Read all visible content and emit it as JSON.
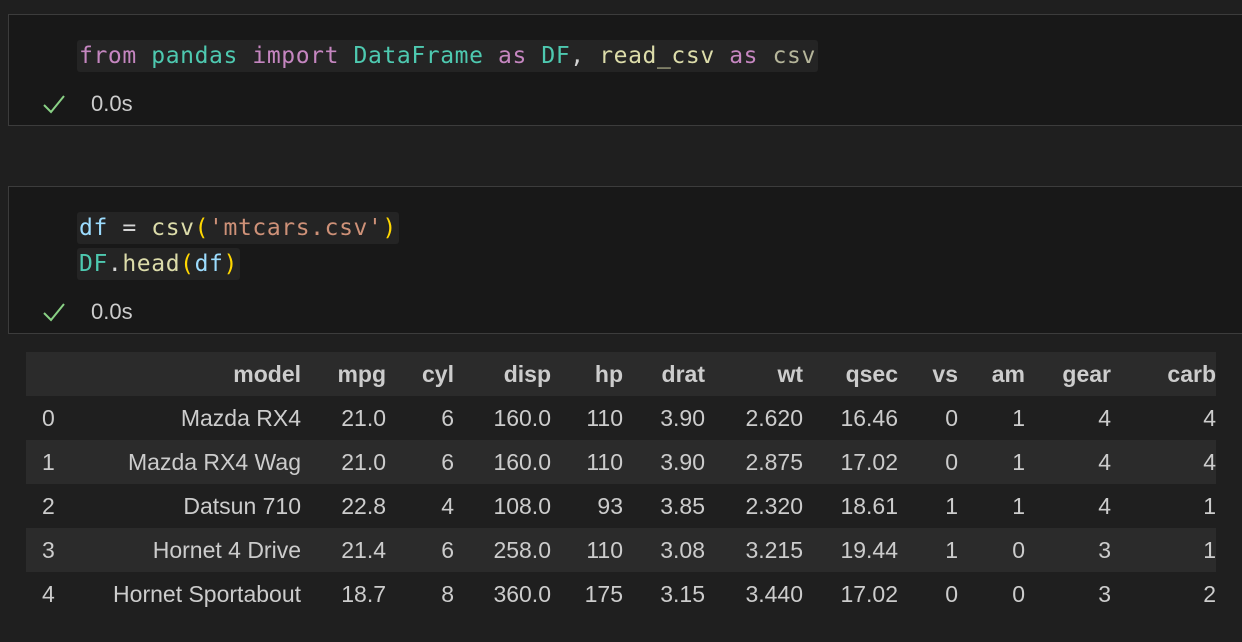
{
  "cells": [
    {
      "code_lines": [
        [
          {
            "t": "from",
            "c": "kw"
          },
          {
            "t": " ",
            "c": "op"
          },
          {
            "t": "pandas",
            "c": "mod"
          },
          {
            "t": " ",
            "c": "op"
          },
          {
            "t": "import",
            "c": "kw"
          },
          {
            "t": " ",
            "c": "op"
          },
          {
            "t": "DataFrame",
            "c": "mod"
          },
          {
            "t": " ",
            "c": "op"
          },
          {
            "t": "as",
            "c": "kw"
          },
          {
            "t": " ",
            "c": "op"
          },
          {
            "t": "DF",
            "c": "mod"
          },
          {
            "t": ", ",
            "c": "op"
          },
          {
            "t": "read_csv",
            "c": "fn"
          },
          {
            "t": " ",
            "c": "op"
          },
          {
            "t": "as",
            "c": "kw"
          },
          {
            "t": " ",
            "c": "op"
          },
          {
            "t": "csv",
            "c": "alias2"
          }
        ]
      ],
      "status": {
        "icon": "check-icon",
        "time": "0.0s"
      }
    },
    {
      "code_lines": [
        [
          {
            "t": "df",
            "c": "var"
          },
          {
            "t": " = ",
            "c": "op"
          },
          {
            "t": "csv",
            "c": "fn"
          },
          {
            "t": "(",
            "c": "par"
          },
          {
            "t": "'mtcars.csv'",
            "c": "str"
          },
          {
            "t": ")",
            "c": "par"
          }
        ],
        [
          {
            "t": "DF",
            "c": "mod"
          },
          {
            "t": ".",
            "c": "op"
          },
          {
            "t": "head",
            "c": "fn"
          },
          {
            "t": "(",
            "c": "par"
          },
          {
            "t": "df",
            "c": "var"
          },
          {
            "t": ")",
            "c": "par"
          }
        ]
      ],
      "status": {
        "icon": "check-icon",
        "time": "0.0s"
      }
    }
  ],
  "output_table": {
    "columns": [
      "",
      "model",
      "mpg",
      "cyl",
      "disp",
      "hp",
      "drat",
      "wt",
      "qsec",
      "vs",
      "am",
      "gear",
      "carb"
    ],
    "rows": [
      [
        "0",
        "Mazda RX4",
        "21.0",
        "6",
        "160.0",
        "110",
        "3.90",
        "2.620",
        "16.46",
        "0",
        "1",
        "4",
        "4"
      ],
      [
        "1",
        "Mazda RX4 Wag",
        "21.0",
        "6",
        "160.0",
        "110",
        "3.90",
        "2.875",
        "17.02",
        "0",
        "1",
        "4",
        "4"
      ],
      [
        "2",
        "Datsun 710",
        "22.8",
        "4",
        "108.0",
        "93",
        "3.85",
        "2.320",
        "18.61",
        "1",
        "1",
        "4",
        "1"
      ],
      [
        "3",
        "Hornet 4 Drive",
        "21.4",
        "6",
        "258.0",
        "110",
        "3.08",
        "3.215",
        "19.44",
        "1",
        "0",
        "3",
        "1"
      ],
      [
        "4",
        "Hornet Sportabout",
        "18.7",
        "8",
        "360.0",
        "175",
        "3.15",
        "3.440",
        "17.02",
        "0",
        "0",
        "3",
        "2"
      ]
    ]
  },
  "colors": {
    "background": "#1f1f1f",
    "cell_background": "#181818",
    "success_check": "#89d185",
    "keyword": "#c586c0",
    "module": "#4ec9b0",
    "function": "#dcdcaa",
    "variable": "#9cdcfe",
    "string": "#ce9178"
  }
}
